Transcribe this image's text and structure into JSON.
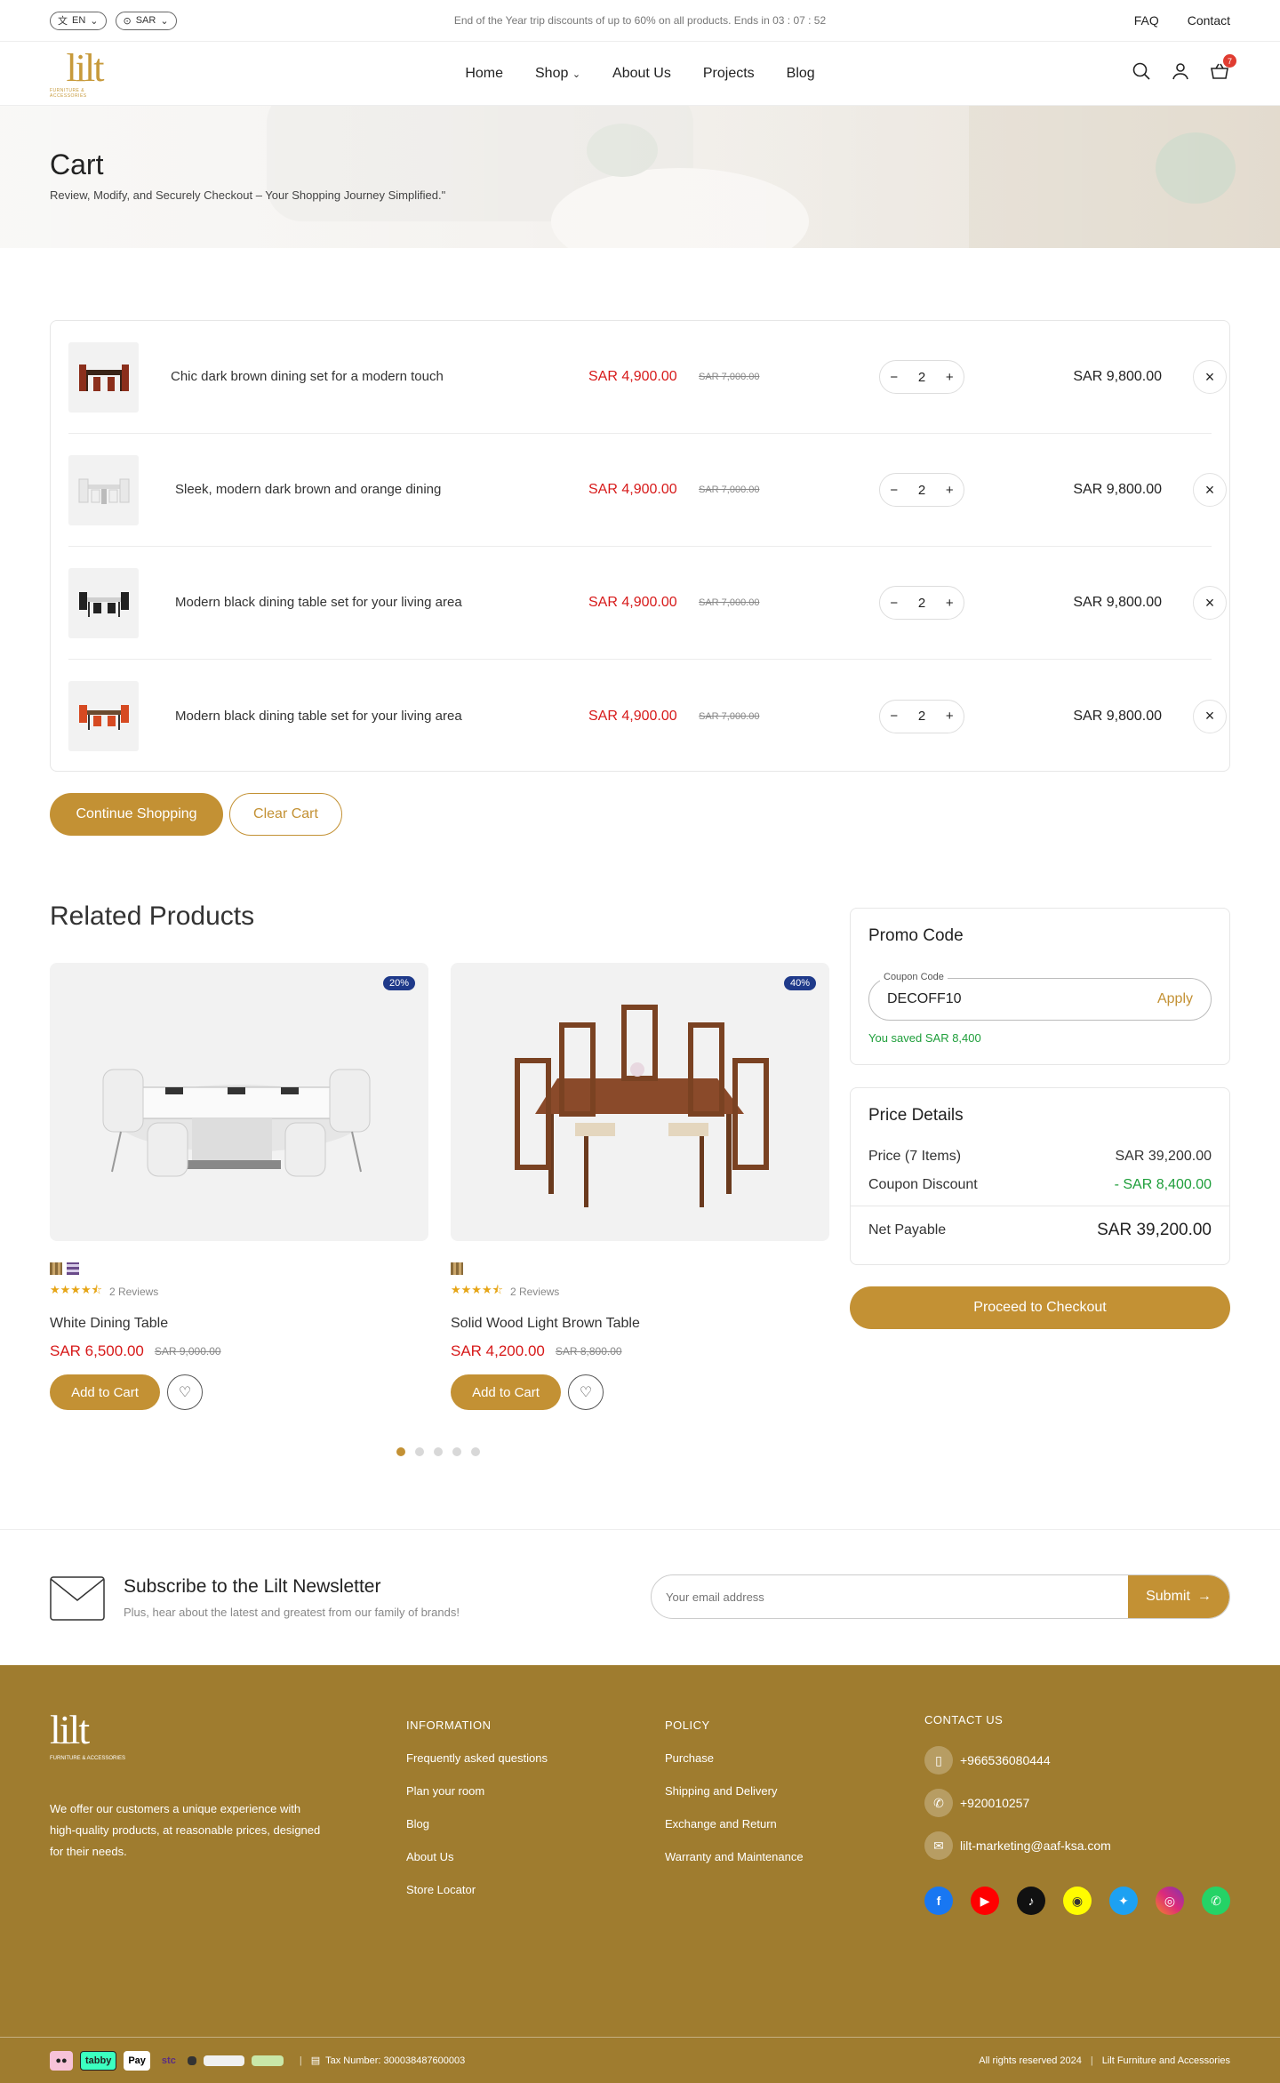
{
  "topbar": {
    "lang": "EN",
    "currency": "SAR",
    "message": "End of the Year trip discounts of up to 60% on all products. Ends in 03 : 07 : 52",
    "links": [
      "FAQ",
      "Contact"
    ]
  },
  "header": {
    "logo": "lilt",
    "logo_sub": "FURNITURE & ACCESSORIES",
    "nav": [
      "Home",
      "Shop",
      "About Us",
      "Projects",
      "Blog"
    ],
    "cart_count": "7"
  },
  "hero": {
    "title": "Cart",
    "subtitle": "Review, Modify, and Securely Checkout – Your Shopping Journey Simplified.\""
  },
  "cart": {
    "items": [
      {
        "name": "Chic dark brown dining set for a modern touch",
        "price": "SAR 4,900.00",
        "old_price": "SAR 7,000.00",
        "qty": "2",
        "total": "SAR 9,800.00"
      },
      {
        "name": "Sleek, modern dark brown and orange dining",
        "price": "SAR 4,900.00",
        "old_price": "SAR 7,000.00",
        "qty": "2",
        "total": "SAR 9,800.00"
      },
      {
        "name": "Modern black dining table set for your living area",
        "price": "SAR 4,900.00",
        "old_price": "SAR 7,000.00",
        "qty": "2",
        "total": "SAR 9,800.00"
      },
      {
        "name": "Modern black dining table set for your living area",
        "price": "SAR 4,900.00",
        "old_price": "SAR 7,000.00",
        "qty": "2",
        "total": "SAR 9,800.00"
      }
    ],
    "continue_label": "Continue Shopping",
    "clear_label": "Clear Cart"
  },
  "related": {
    "title": "Related Products",
    "products": [
      {
        "discount": "20%",
        "reviews": "2 Reviews",
        "rating": 4.5,
        "name": "White Dining Table",
        "price": "SAR 6,500.00",
        "old_price": "SAR 9,000.00",
        "cta": "Add to Cart"
      },
      {
        "discount": "40%",
        "reviews": "2 Reviews",
        "rating": 4.5,
        "name": "Solid Wood Light Brown Table",
        "price": "SAR 4,200.00",
        "old_price": "SAR 8,800.00",
        "cta": "Add to Cart"
      }
    ]
  },
  "promo": {
    "title": "Promo Code",
    "field_label": "Coupon Code",
    "code": "DECOFF10",
    "apply": "Apply",
    "saved": "You saved SAR 8,400"
  },
  "price_details": {
    "title": "Price Details",
    "price_label": "Price (7 Items)",
    "price_value": "SAR 39,200.00",
    "coupon_label": "Coupon Discount",
    "coupon_value": "- SAR 8,400.00",
    "net_label": "Net Payable",
    "net_value": "SAR 39,200.00",
    "checkout": "Proceed to Checkout"
  },
  "newsletter": {
    "title": "Subscribe to the Lilt Newsletter",
    "subtitle": "Plus, hear about the latest and greatest from our family of brands!",
    "placeholder": "Your email address",
    "submit": "Submit"
  },
  "footer": {
    "about": "We offer our customers a unique experience with high-quality products, at reasonable prices, designed for their needs.",
    "info_title": "INFORMATION",
    "info_links": [
      "Frequently asked questions",
      "Plan your room",
      "Blog",
      "About Us",
      "Store Locator"
    ],
    "policy_title": "POLICY",
    "policy_links": [
      "Purchase",
      "Shipping and Delivery",
      "Exchange and Return",
      "Warranty and Maintenance"
    ],
    "contact_title": "CONTACT US",
    "mobile": "+966536080444",
    "phone": "+920010257",
    "email": "lilt-marketing@aaf-ksa.com",
    "tax": "Tax Number: 300038487600003",
    "rights": "All rights reserved 2024",
    "company": "Lilt Furniture and Accessories",
    "pay_tabby": "tabby",
    "pay_applepay": "Pay",
    "pay_stc": "stc"
  },
  "colors": {
    "accent": "#c39134",
    "footer": "#9f7c2f",
    "sale": "#d71a1a",
    "saved": "#1e9e3a",
    "badge": "#1f3a8a"
  }
}
